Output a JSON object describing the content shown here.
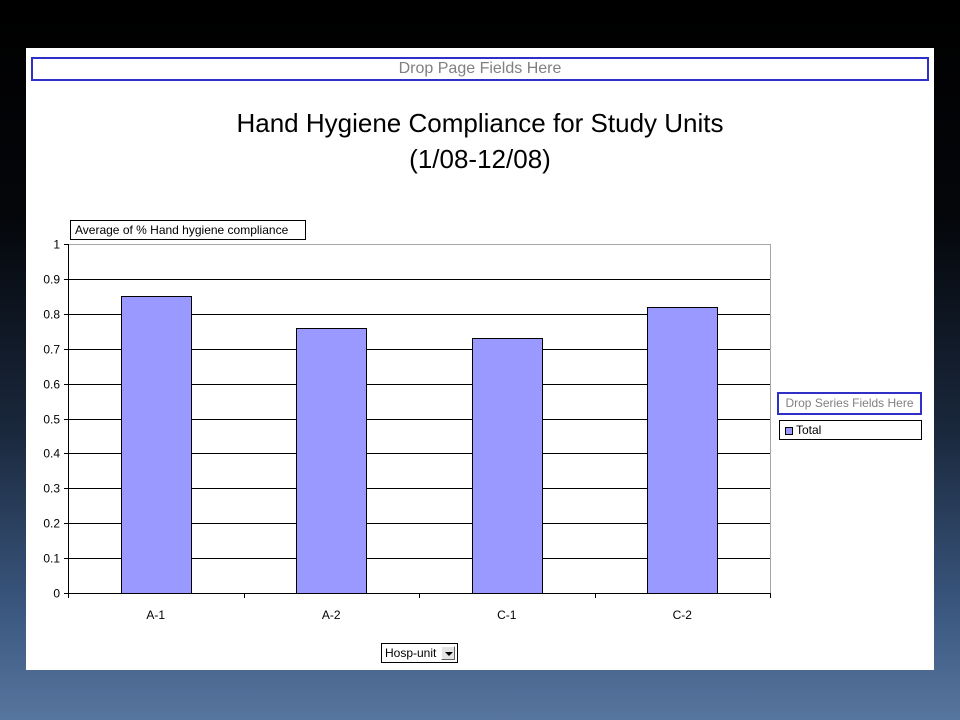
{
  "pivot": {
    "page_drop_label": "Drop Page Fields Here",
    "series_drop_label": "Drop Series Fields Here"
  },
  "icons": {
    "category_dropdown": "triangle-down-icon"
  },
  "colors": {
    "bar": "#9999ff",
    "drop_zone_border": "#3030c8",
    "drop_zone_text": "#808080"
  },
  "chart_data": {
    "type": "bar",
    "title": "Hand Hygiene Compliance for Study Units",
    "subtitle": "(1/08-12/08)",
    "ylabel": "Average of % Hand hygiene compliance",
    "xlabel": "Hosp-unit",
    "categories": [
      "A-1",
      "A-2",
      "C-1",
      "C-2"
    ],
    "series": [
      {
        "name": "Total",
        "values": [
          0.85,
          0.76,
          0.73,
          0.82
        ]
      }
    ],
    "ylim": [
      0,
      1
    ],
    "yticks": [
      "0",
      "0.1",
      "0.2",
      "0.3",
      "0.4",
      "0.5",
      "0.6",
      "0.7",
      "0.8",
      "0.9",
      "1"
    ],
    "grid": true,
    "legend_position": "right"
  }
}
